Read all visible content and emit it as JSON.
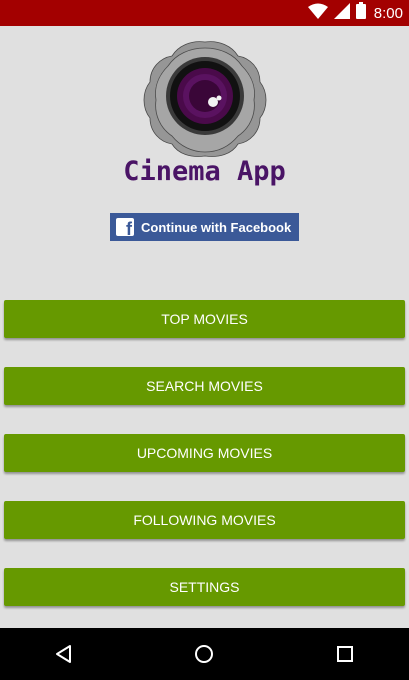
{
  "status_bar": {
    "time": "8:00",
    "background": "#a30000",
    "icons": [
      "wifi-icon",
      "cell-signal-icon",
      "battery-icon"
    ]
  },
  "header": {
    "app_title": "Cinema App",
    "logo_icon": "camera-lens-logo"
  },
  "facebook_button": {
    "label": "Continue with Facebook",
    "color": "#3b5998",
    "icon": "facebook-icon"
  },
  "menu": {
    "color": "#669900",
    "buttons": [
      {
        "label": "TOP MOVIES"
      },
      {
        "label": "SEARCH MOVIES"
      },
      {
        "label": "UPCOMING MOVIES"
      },
      {
        "label": "FOLLOWING MOVIES"
      },
      {
        "label": "SETTINGS"
      }
    ]
  },
  "nav_bar": {
    "icons": [
      "back-icon",
      "home-icon",
      "recents-icon"
    ]
  }
}
